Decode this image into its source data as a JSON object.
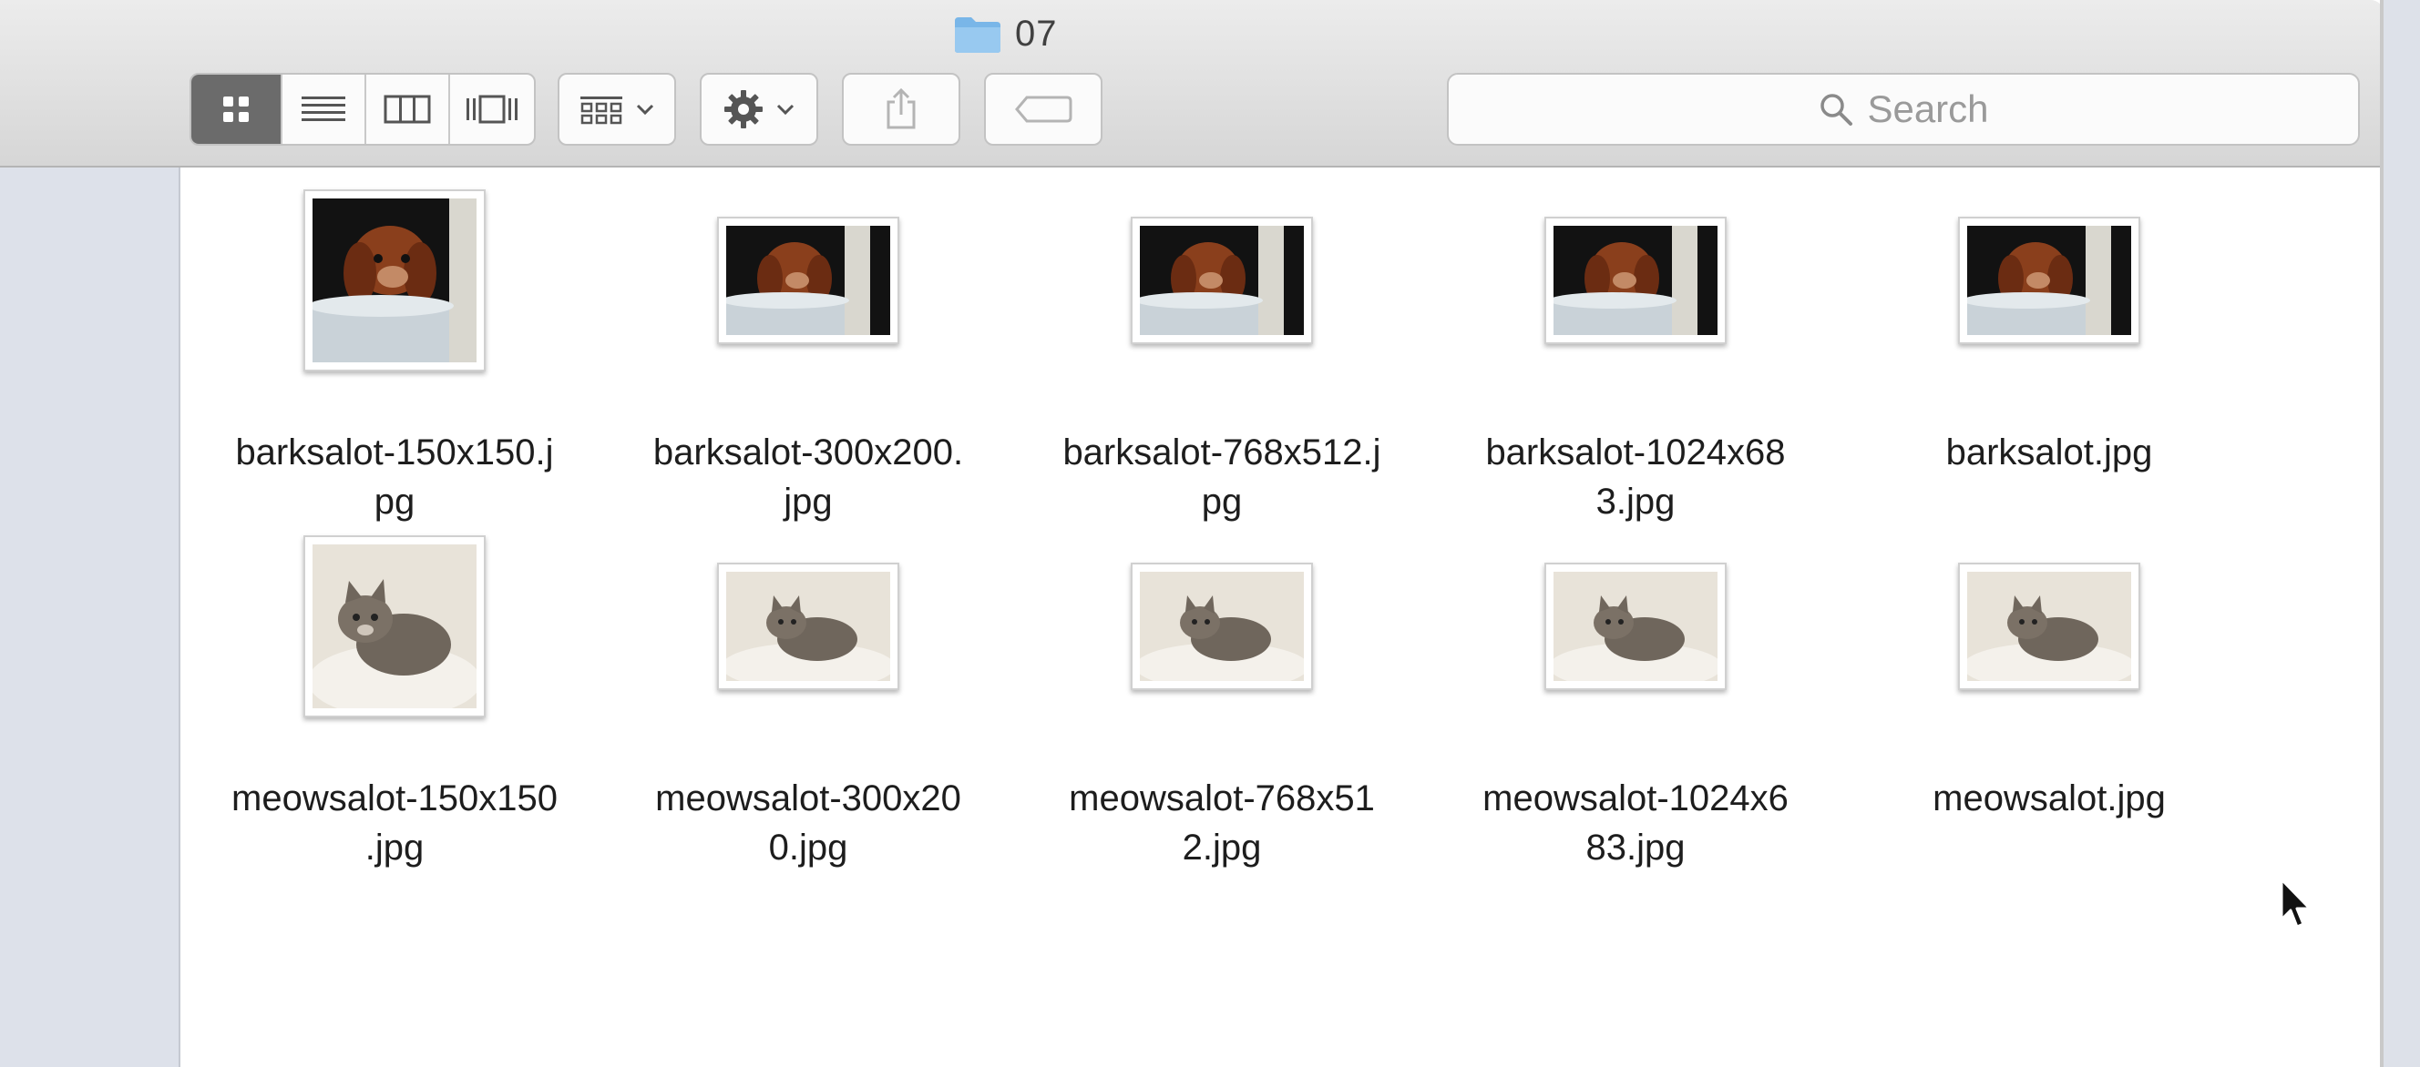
{
  "window": {
    "title": "07"
  },
  "toolbar": {
    "view_modes": [
      "icon-view-icon",
      "list-view-icon",
      "column-view-icon",
      "cover-flow-icon"
    ],
    "arrange_icon": "arrange-grid-icon",
    "action_icon": "gear-icon",
    "share_icon": "share-icon",
    "tag_icon": "tag-icon"
  },
  "search": {
    "placeholder": "Search"
  },
  "files": [
    {
      "name": "barksalot-150x150.jpg",
      "line1": "barksalot-150x150.j",
      "line2": "pg",
      "kind": "dog"
    },
    {
      "name": "barksalot-300x200.jpg",
      "line1": "barksalot-300x200.",
      "line2": "jpg",
      "kind": "dog"
    },
    {
      "name": "barksalot-768x512.jpg",
      "line1": "barksalot-768x512.j",
      "line2": "pg",
      "kind": "dog"
    },
    {
      "name": "barksalot-1024x683.jpg",
      "line1": "barksalot-1024x68",
      "line2": "3.jpg",
      "kind": "dog"
    },
    {
      "name": "barksalot.jpg",
      "line1": "barksalot.jpg",
      "line2": "",
      "kind": "dog"
    },
    {
      "name": "meowsalot-150x150.jpg",
      "line1": "meowsalot-150x150",
      "line2": ".jpg",
      "kind": "cat"
    },
    {
      "name": "meowsalot-300x200.jpg",
      "line1": "meowsalot-300x20",
      "line2": "0.jpg",
      "kind": "cat"
    },
    {
      "name": "meowsalot-768x512.jpg",
      "line1": "meowsalot-768x51",
      "line2": "2.jpg",
      "kind": "cat"
    },
    {
      "name": "meowsalot-1024x683.jpg",
      "line1": "meowsalot-1024x6",
      "line2": "83.jpg",
      "kind": "cat"
    },
    {
      "name": "meowsalot.jpg",
      "line1": "meowsalot.jpg",
      "line2": "",
      "kind": "cat"
    }
  ],
  "colors": {
    "sidebar": "#dde1ea",
    "toolbar": "#e2e2e2",
    "active_view": "#6b6b6b"
  }
}
